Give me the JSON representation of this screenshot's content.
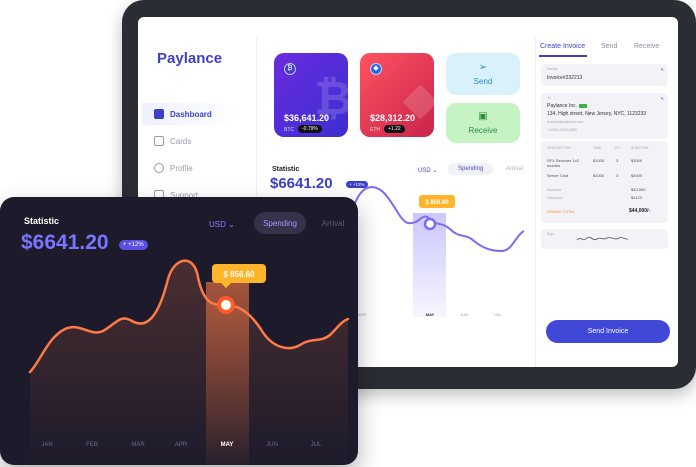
{
  "app": {
    "name": "Paylance"
  },
  "sidebar": {
    "items": [
      {
        "label": "Dashboard",
        "active": true
      },
      {
        "label": "Cards",
        "active": false
      },
      {
        "label": "Profile",
        "active": false
      },
      {
        "label": "Support",
        "active": false
      }
    ]
  },
  "cards": [
    {
      "amount": "$36,641.20",
      "symbol": "BTC",
      "change": "-0.79%",
      "color": "#5a2ee0"
    },
    {
      "amount": "$28,312.20",
      "symbol": "ETH",
      "change": "+1.22",
      "color": "#e83a55"
    }
  ],
  "actions": {
    "send": "Send",
    "receive": "Receive"
  },
  "statistic": {
    "title": "Statistic",
    "value": "$6641.20",
    "badge": "+ +12%",
    "currency": "USD",
    "tabs": [
      "Spending",
      "Arrival"
    ],
    "tooltip": "$ 856.60",
    "months": [
      "JAN",
      "FEB",
      "MAR",
      "APR",
      "MAY",
      "JUN",
      "JUL"
    ],
    "small_months": [
      "APR",
      "MAY",
      "JUN",
      "JUL"
    ],
    "highlight_month": "MAY",
    "line_color": "#ff7a45",
    "accent": "#7a74ff"
  },
  "invoice": {
    "tabs": [
      "Create Invoice",
      "Send",
      "Receive"
    ],
    "invoice_label": "Invoice",
    "invoice_id": "Invoice#232213",
    "to_label": "To",
    "company": "Paylance Inc.",
    "address": "134, High street, New Jersey, NYC, 1123233",
    "email": "finance@paylance.com",
    "phone": "+12331-2435-3355",
    "table_headers": [
      "DESCRIPTION",
      "TIME",
      "QTY",
      "SUBTOTAL"
    ],
    "rows": [
      {
        "desc": "SFX Services 1x2 months",
        "time": "$1000",
        "qty": "3",
        "subtotal": "$3000"
      },
      {
        "desc": "Server Cost",
        "time": "$1000",
        "qty": "3",
        "subtotal": "$3000"
      }
    ],
    "number_label": "Number",
    "number_value": "$43,050",
    "discount_label": "Discount",
    "discount_value": "$1123",
    "grand_total_label": "GRAND TOTAL",
    "grand_total_value": "$44,000/-",
    "sign_label": "Sign",
    "send_button": "Send Invoice"
  }
}
